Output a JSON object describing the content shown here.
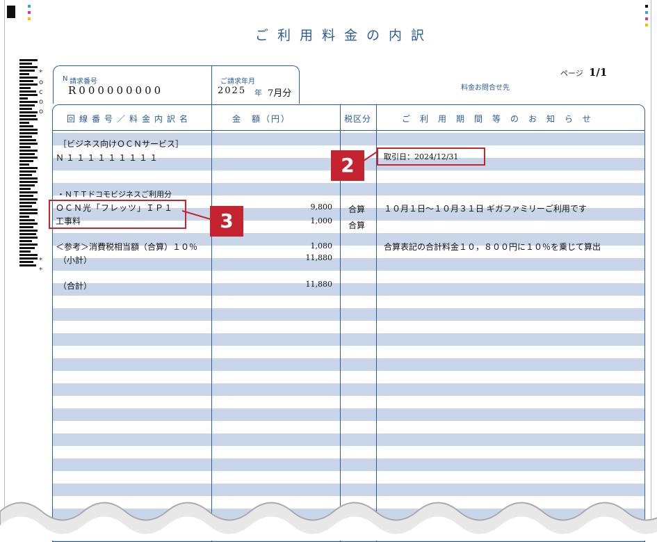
{
  "document": {
    "title": "ご利用料金の内訳",
    "barcode_chars": [
      "*",
      "o",
      "c",
      "o",
      "o",
      "*",
      "*"
    ],
    "page_label": "ページ",
    "page_number": "1/1",
    "contact_label": "料金お問合せ先"
  },
  "header": {
    "invoice_label": "請求番号",
    "invoice_value": "R000000000",
    "billing_label": "ご請求年月",
    "billing_year": "2025",
    "billing_year_unit": "年",
    "billing_month": "7月分"
  },
  "table": {
    "columns": [
      "回線番号／料金内訳名",
      "金　額（円）",
      "税区分",
      "ご利用期間等のお知らせ"
    ],
    "rows": [
      {
        "name": "［ビジネス向けＯＣＮサービス］",
        "amount": "",
        "tax": "",
        "note": ""
      },
      {
        "name": "Ｎ１１１１１１１１１",
        "amount": "",
        "tax": "",
        "note": "取引日：2024/12/31"
      },
      {
        "name": "・ＮＴＴドコモビジネスご利用分",
        "amount": "",
        "tax": "",
        "note": ""
      },
      {
        "name": "ＯＣＮ光「フレッツ」ＩＰ１",
        "amount": "9,800",
        "tax": "合算",
        "note": "１０月１日～１０月３１日 ギガファミリーご利用です"
      },
      {
        "name": "工事料",
        "amount": "1,000",
        "tax": "合算",
        "note": ""
      },
      {
        "name": "＜参考＞消費税相当額（合算）１０％",
        "amount": "1,080",
        "tax": "",
        "note": "合算表記の合計料金１０，８００円に１０％を乗じて算出"
      },
      {
        "name": "（小計）",
        "amount": "11,880",
        "tax": "",
        "note": ""
      },
      {
        "name": "（合計）",
        "amount": "11,880",
        "tax": "",
        "note": ""
      }
    ]
  },
  "callouts": {
    "two": "2",
    "three": "3"
  },
  "colors": {
    "accent": "#2a5d9a",
    "stripe": "#c9d6ea",
    "callout": "#c4242f"
  }
}
